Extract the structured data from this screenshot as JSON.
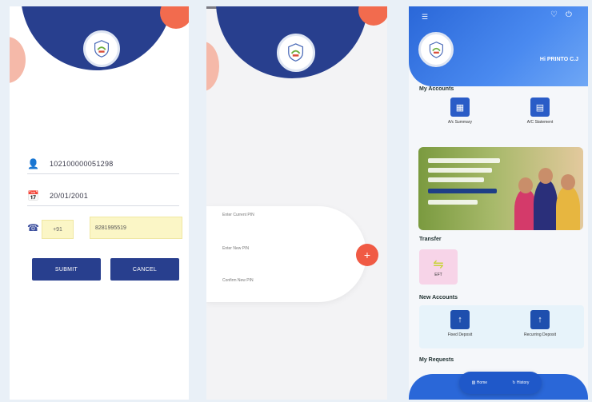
{
  "screen1": {
    "account_number": "102100000051298",
    "dob": "20/01/2001",
    "country_code": "+91",
    "mobile": "8281995519",
    "submit_label": "SUBMIT",
    "cancel_label": "CANCEL"
  },
  "screen2": {
    "current_pin_label": "Enter Current PIN",
    "new_pin_label": "Enter New PIN",
    "confirm_pin_label": "Confirm New PIN",
    "fab_symbol": "+"
  },
  "screen3": {
    "greeting": "Hi PRINTO C.J",
    "my_accounts_title": "My Accounts",
    "ac_summary_label": "A/c Summary",
    "ac_statement_label": "A/C Statement",
    "transfer_title": "Transfer",
    "eft_label": "EFT",
    "new_accounts_title": "New Accounts",
    "fixed_deposit_label": "Fixed Deposit",
    "recurring_deposit_label": "Recurring Deposit",
    "my_requests_title": "My Requests",
    "nav_home_label": "Home",
    "nav_history_label": "History"
  },
  "colors": {
    "primary_navy": "#283f8e",
    "accent_orange": "#f26b4e",
    "app_blue": "#2a67d8",
    "highlight_yellow": "#fbf6c6"
  }
}
